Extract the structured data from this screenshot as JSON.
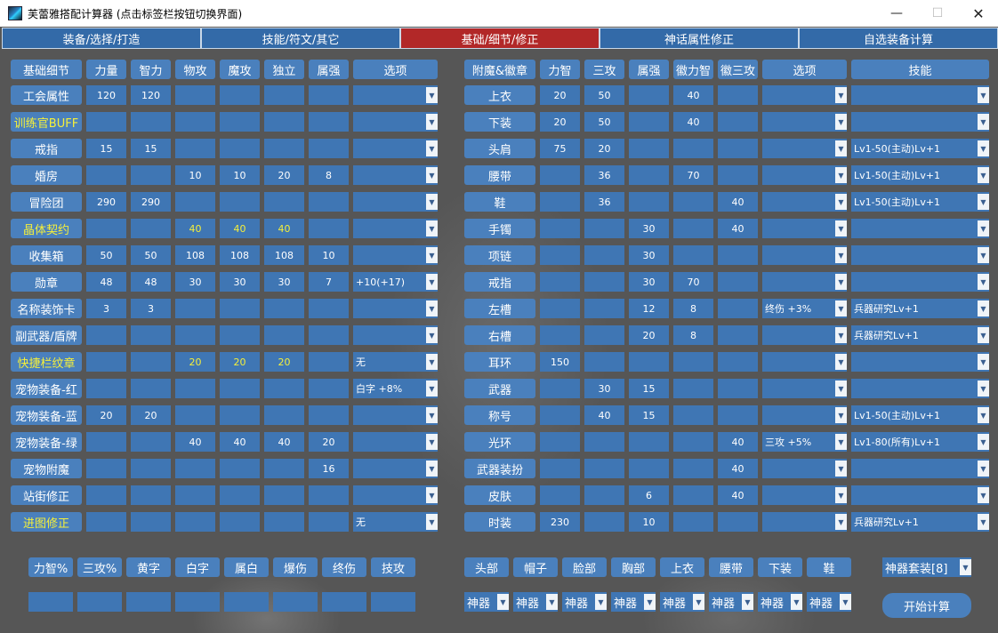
{
  "window": {
    "title": "芙蕾雅搭配计算器 (点击标签栏按钮切换界面)",
    "minimize": "—",
    "maximize": "☐",
    "close": "✕"
  },
  "tabs": [
    {
      "label": "装备/选择/打造",
      "active": false
    },
    {
      "label": "技能/符文/其它",
      "active": false
    },
    {
      "label": "基础/细节/修正",
      "active": true
    },
    {
      "label": "神话属性修正",
      "active": false
    },
    {
      "label": "自选装备计算",
      "active": false
    }
  ],
  "left_table": {
    "headers": [
      "基础细节",
      "力量",
      "智力",
      "物攻",
      "魔攻",
      "独立",
      "属强",
      "选项"
    ],
    "rows": [
      {
        "label": "工会属性",
        "highlight": false,
        "values": [
          "120",
          "120",
          "",
          "",
          "",
          ""
        ],
        "option": ""
      },
      {
        "label": "训练官BUFF",
        "highlight": true,
        "values": [
          "",
          "",
          "",
          "",
          "",
          ""
        ],
        "option": ""
      },
      {
        "label": "戒指",
        "highlight": false,
        "values": [
          "15",
          "15",
          "",
          "",
          "",
          ""
        ],
        "option": ""
      },
      {
        "label": "婚房",
        "highlight": false,
        "values": [
          "",
          "",
          "10",
          "10",
          "20",
          "8"
        ],
        "option": ""
      },
      {
        "label": "冒险团",
        "highlight": false,
        "values": [
          "290",
          "290",
          "",
          "",
          "",
          ""
        ],
        "option": ""
      },
      {
        "label": "晶体契约",
        "highlight": true,
        "values": [
          "",
          "",
          "40",
          "40",
          "40",
          ""
        ],
        "option": ""
      },
      {
        "label": "收集箱",
        "highlight": false,
        "values": [
          "50",
          "50",
          "108",
          "108",
          "108",
          "10"
        ],
        "option": ""
      },
      {
        "label": "勋章",
        "highlight": false,
        "values": [
          "48",
          "48",
          "30",
          "30",
          "30",
          "7"
        ],
        "option": "+10(+17)"
      },
      {
        "label": "名称装饰卡",
        "highlight": false,
        "values": [
          "3",
          "3",
          "",
          "",
          "",
          ""
        ],
        "option": ""
      },
      {
        "label": "副武器/盾牌",
        "highlight": false,
        "values": [
          "",
          "",
          "",
          "",
          "",
          ""
        ],
        "option": ""
      },
      {
        "label": "快捷栏纹章",
        "highlight": true,
        "values": [
          "",
          "",
          "20",
          "20",
          "20",
          ""
        ],
        "option": "无"
      },
      {
        "label": "宠物装备-红",
        "highlight": false,
        "values": [
          "",
          "",
          "",
          "",
          "",
          ""
        ],
        "option": "白字 +8%"
      },
      {
        "label": "宠物装备-蓝",
        "highlight": false,
        "values": [
          "20",
          "20",
          "",
          "",
          "",
          ""
        ],
        "option": ""
      },
      {
        "label": "宠物装备-绿",
        "highlight": false,
        "values": [
          "",
          "",
          "40",
          "40",
          "40",
          "20"
        ],
        "option": ""
      },
      {
        "label": "宠物附魔",
        "highlight": false,
        "values": [
          "",
          "",
          "",
          "",
          "",
          "16"
        ],
        "option": ""
      },
      {
        "label": "站街修正",
        "highlight": false,
        "values": [
          "",
          "",
          "",
          "",
          "",
          ""
        ],
        "option": ""
      },
      {
        "label": "进图修正",
        "highlight": true,
        "values": [
          "",
          "",
          "",
          "",
          "",
          ""
        ],
        "option": "无"
      }
    ]
  },
  "right_table": {
    "headers": [
      "附魔&徽章",
      "力智",
      "三攻",
      "属强",
      "徽力智",
      "徽三攻",
      "选项",
      "技能"
    ],
    "rows": [
      {
        "label": "上衣",
        "values": [
          "20",
          "50",
          "",
          "40",
          ""
        ],
        "option": "",
        "skill": ""
      },
      {
        "label": "下装",
        "values": [
          "20",
          "50",
          "",
          "40",
          ""
        ],
        "option": "",
        "skill": ""
      },
      {
        "label": "头肩",
        "values": [
          "75",
          "20",
          "",
          "",
          ""
        ],
        "option": "",
        "skill": "Lv1-50(主动)Lv+1"
      },
      {
        "label": "腰带",
        "values": [
          "",
          "36",
          "",
          "70",
          ""
        ],
        "option": "",
        "skill": "Lv1-50(主动)Lv+1"
      },
      {
        "label": "鞋",
        "values": [
          "",
          "36",
          "",
          "",
          "40"
        ],
        "option": "",
        "skill": "Lv1-50(主动)Lv+1"
      },
      {
        "label": "手镯",
        "values": [
          "",
          "",
          "30",
          "",
          "40"
        ],
        "option": "",
        "skill": ""
      },
      {
        "label": "项链",
        "values": [
          "",
          "",
          "30",
          "",
          ""
        ],
        "option": "",
        "skill": ""
      },
      {
        "label": "戒指",
        "values": [
          "",
          "",
          "30",
          "70",
          ""
        ],
        "option": "",
        "skill": ""
      },
      {
        "label": "左槽",
        "values": [
          "",
          "",
          "12",
          "8",
          ""
        ],
        "option": "终伤 +3%",
        "skill": "兵器研究Lv+1"
      },
      {
        "label": "右槽",
        "values": [
          "",
          "",
          "20",
          "8",
          ""
        ],
        "option": "",
        "skill": "兵器研究Lv+1"
      },
      {
        "label": "耳环",
        "values": [
          "150",
          "",
          "",
          "",
          ""
        ],
        "option": "",
        "skill": ""
      },
      {
        "label": "武器",
        "values": [
          "",
          "30",
          "15",
          "",
          ""
        ],
        "option": "",
        "skill": ""
      },
      {
        "label": "称号",
        "values": [
          "",
          "40",
          "15",
          "",
          ""
        ],
        "option": "",
        "skill": "Lv1-50(主动)Lv+1"
      },
      {
        "label": "光环",
        "values": [
          "",
          "",
          "",
          "",
          "40"
        ],
        "option": "三攻 +5%",
        "skill": "Lv1-80(所有)Lv+1"
      },
      {
        "label": "武器装扮",
        "values": [
          "",
          "",
          "",
          "",
          "40"
        ],
        "option": "",
        "skill": ""
      },
      {
        "label": "皮肤",
        "values": [
          "",
          "",
          "6",
          "",
          "40"
        ],
        "option": "",
        "skill": ""
      },
      {
        "label": "时装",
        "values": [
          "230",
          "",
          "10",
          "",
          ""
        ],
        "option": "",
        "skill": "兵器研究Lv+1"
      }
    ]
  },
  "bottom_left": {
    "buttons": [
      "力智%",
      "三攻%",
      "黄字",
      "白字",
      "属白",
      "爆伤",
      "终伤",
      "技攻"
    ],
    "values": [
      "",
      "",
      "",
      "",
      "",
      "",
      "",
      ""
    ]
  },
  "bottom_right": {
    "slots": [
      "头部",
      "帽子",
      "脸部",
      "胸部",
      "上衣",
      "腰带",
      "下装",
      "鞋"
    ],
    "selects": [
      "神器",
      "神器",
      "神器",
      "神器",
      "神器",
      "神器",
      "神器",
      "神器"
    ],
    "set_select": "神器套装[8]",
    "start_button": "开始计算"
  },
  "icons": {
    "dropdown": "chevron-down-icon",
    "arrow_glyph": "▼"
  },
  "colors": {
    "cell": "#3f76b4",
    "header": "#4a80bd",
    "active_tab": "#b22828",
    "highlight_text": "#f5ef3a"
  }
}
